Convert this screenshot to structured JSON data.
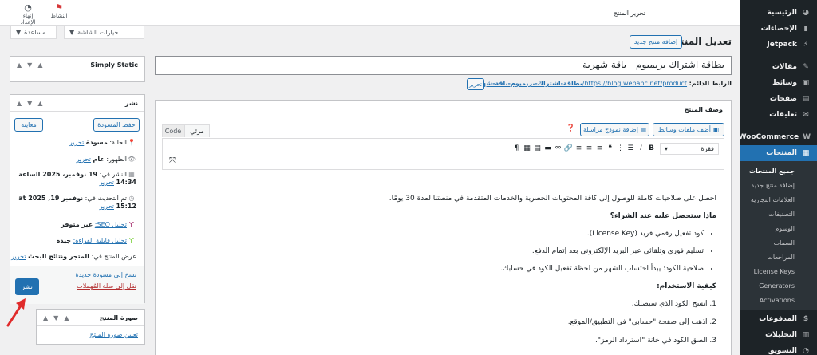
{
  "admin_menu": {
    "items_top": [
      {
        "label": "الرئيسية",
        "icon": "dashboard-icon",
        "glyph": "◕"
      },
      {
        "label": "الإحصاءات",
        "icon": "chart-icon",
        "glyph": "▮"
      },
      {
        "label": "Jetpack",
        "icon": "jetpack-icon",
        "glyph": "⚡"
      }
    ],
    "items_mid": [
      {
        "label": "مقالات",
        "icon": "pin-icon",
        "glyph": "✎"
      },
      {
        "label": "وسائط",
        "icon": "media-icon",
        "glyph": "▣"
      },
      {
        "label": "صفحات",
        "icon": "page-icon",
        "glyph": "▤"
      },
      {
        "label": "تعليقات",
        "icon": "comment-icon",
        "glyph": "✉"
      }
    ],
    "woocommerce": {
      "label": "WooCommerce",
      "glyph": "W"
    },
    "products": {
      "label": "المنتجات",
      "glyph": "▦"
    },
    "products_sub": [
      "جميع المنتجات",
      "إضافة منتج جديد",
      "العلامات التجارية",
      "التصنيفات",
      "الوسوم",
      "السمات",
      "المراجعات",
      "License Keys",
      "Generators",
      "Activations"
    ],
    "items_bottom": [
      {
        "label": "المدفوعات",
        "icon": "payments-icon",
        "glyph": "$"
      },
      {
        "label": "التحليلات",
        "icon": "analytics-icon",
        "glyph": "▥"
      },
      {
        "label": "التسويق",
        "icon": "marketing-icon",
        "glyph": "◔"
      }
    ]
  },
  "topbar": {
    "title": "تحرير المنتج",
    "activity_label": "النشاط",
    "finish_setup_label": "إنهاء الإعداد"
  },
  "screen_tabs": {
    "help": "مساعدة",
    "screen_options": "خيارات الشاشة"
  },
  "page": {
    "heading": "تعديل المنتج",
    "add_new": "إضافة منتج جديد",
    "title_value": "بطاقة اشتراك بريميوم - باقة شهرية",
    "permalink_label": "الرابط الدائم:",
    "permalink_base": "https://blog.webabc.net/product/",
    "permalink_slug": "بطاقة-اشتراك-بريميوم-باقة-شهرية/",
    "permalink_edit": "تحرير"
  },
  "editor": {
    "box_title": "وصف المنتج",
    "add_media": "أضف ملفات وسائط",
    "add_form": "إضافة نموذج مراسلة",
    "tab_visual": "مرئي",
    "tab_code": "Code",
    "format_select": "فقرة",
    "intro": "احصل على صلاحيات كاملة للوصول إلى كافة المحتويات الحصرية والخدمات المتقدمة في منصتنا لمدة 30 يومًا.",
    "heading1": "ماذا ستحصل عليه عند الشراء؟",
    "bullets": [
      "كود تفعيل رقمي فريد (License Key).",
      "تسليم فوري وتلقائي عبر البريد الإلكتروني بعد إتمام الدفع.",
      "صلاحية الكود: يبدأ احتساب الشهر من لحظة تفعيل الكود في حسابك."
    ],
    "heading2": "كيفية الاستخدام:",
    "steps": [
      "1. انسخ الكود الذي سيصلك.",
      "2. اذهب إلى صفحة \"حسابي\" في التطبيق/الموقع.",
      "3. الصق الكود في خانة \"استرداد الرمز\"."
    ]
  },
  "simply_static": {
    "title": "Simply Static"
  },
  "publish": {
    "title": "نشر",
    "save_draft": "حفظ المسودة",
    "preview": "معاينة",
    "status_label": "الحالة:",
    "status_value": "مسودة",
    "visibility_label": "الظهور:",
    "visibility_value": "عام",
    "edit": "تحرير",
    "published_label": "النشر في:",
    "published_value": "19 نوفمبر، 2025 الساعة 14:34",
    "updated_label": "تم التحديث في:",
    "updated_value": "نوفمبر 19, 2025 at 15:12",
    "seo_label": "تحليل SEO:",
    "seo_value": "غير متوفر",
    "readability_label": "تحليل قابلية القراءة:",
    "readability_value": "جيدة",
    "catalog_label": "عرض المنتج في:",
    "catalog_value": "المتجر ونتائج البحث",
    "copy_draft": "نسخ إلى مسودة جديدة",
    "trash": "نقل إلى سلة المُهملات",
    "publish_button": "نشر"
  },
  "product_image": {
    "title": "صورة المنتج",
    "set_image": "تعيين صورة المنتج"
  },
  "colors": {
    "menu_bg": "#1d2327",
    "accent": "#2271b1",
    "arrow": "#e02b2b"
  }
}
